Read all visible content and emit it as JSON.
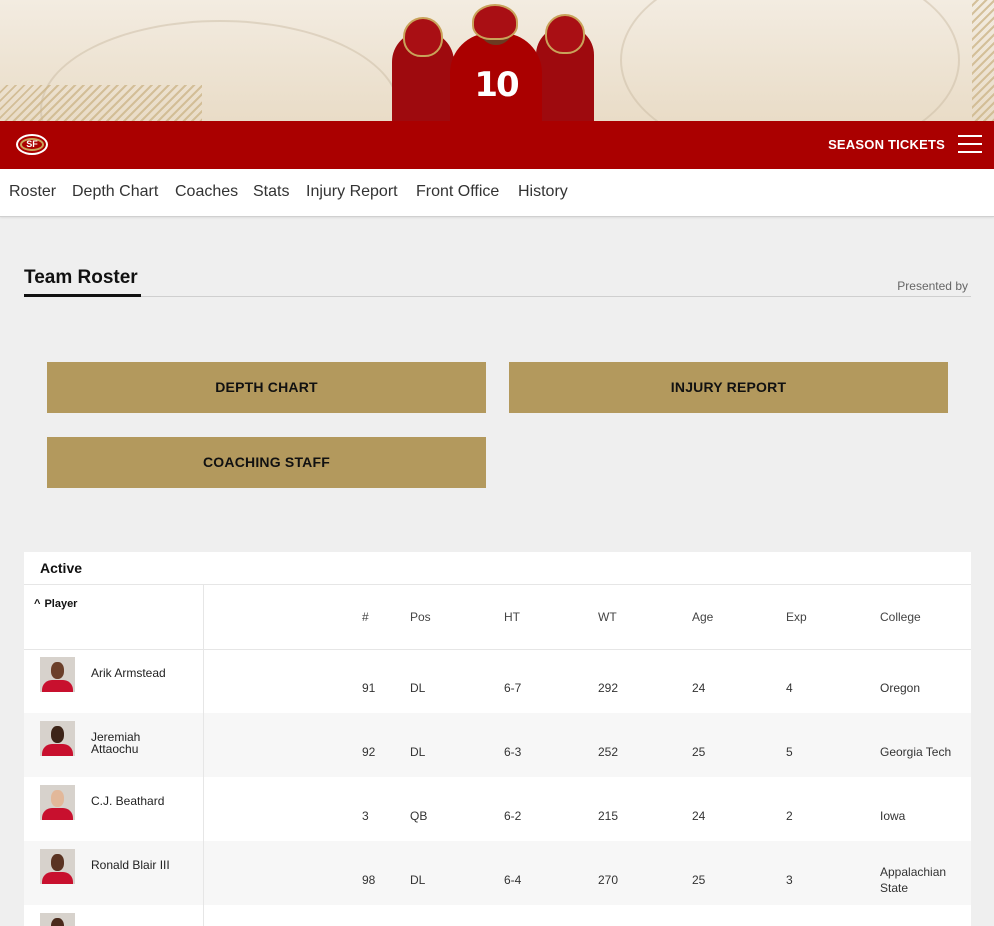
{
  "header": {
    "logo_text": "SF",
    "season_tickets_label": "SEASON TICKETS",
    "jersey_number": "10"
  },
  "subnav": [
    "Roster",
    "Depth Chart",
    "Coaches",
    "Stats",
    "Injury Report",
    "Front Office",
    "History"
  ],
  "page": {
    "title": "Team Roster",
    "presented_by": "Presented by"
  },
  "buttons": {
    "depth_chart": "DEPTH CHART",
    "injury_report": "INJURY REPORT",
    "coaching_staff": "COACHING STAFF"
  },
  "roster": {
    "section": "Active",
    "sort_indicator": "^",
    "columns": {
      "player": "Player",
      "number": "#",
      "pos": "Pos",
      "ht": "HT",
      "wt": "WT",
      "age": "Age",
      "exp": "Exp",
      "college": "College"
    },
    "rows": [
      {
        "name": "Arik Armstead",
        "number": "91",
        "pos": "DL",
        "ht": "6-7",
        "wt": "292",
        "age": "24",
        "exp": "4",
        "college": "Oregon"
      },
      {
        "name": "Jeremiah Attaochu",
        "number": "92",
        "pos": "DL",
        "ht": "6-3",
        "wt": "252",
        "age": "25",
        "exp": "5",
        "college": "Georgia Tech"
      },
      {
        "name": "C.J. Beathard",
        "number": "3",
        "pos": "QB",
        "ht": "6-2",
        "wt": "215",
        "age": "24",
        "exp": "2",
        "college": "Iowa"
      },
      {
        "name": "Ronald Blair III",
        "number": "98",
        "pos": "DL",
        "ht": "6-4",
        "wt": "270",
        "age": "25",
        "exp": "3",
        "college": "Appalachian State"
      }
    ]
  },
  "colors": {
    "red": "#aa0000",
    "gold": "#b3995d",
    "background": "#efefef"
  }
}
